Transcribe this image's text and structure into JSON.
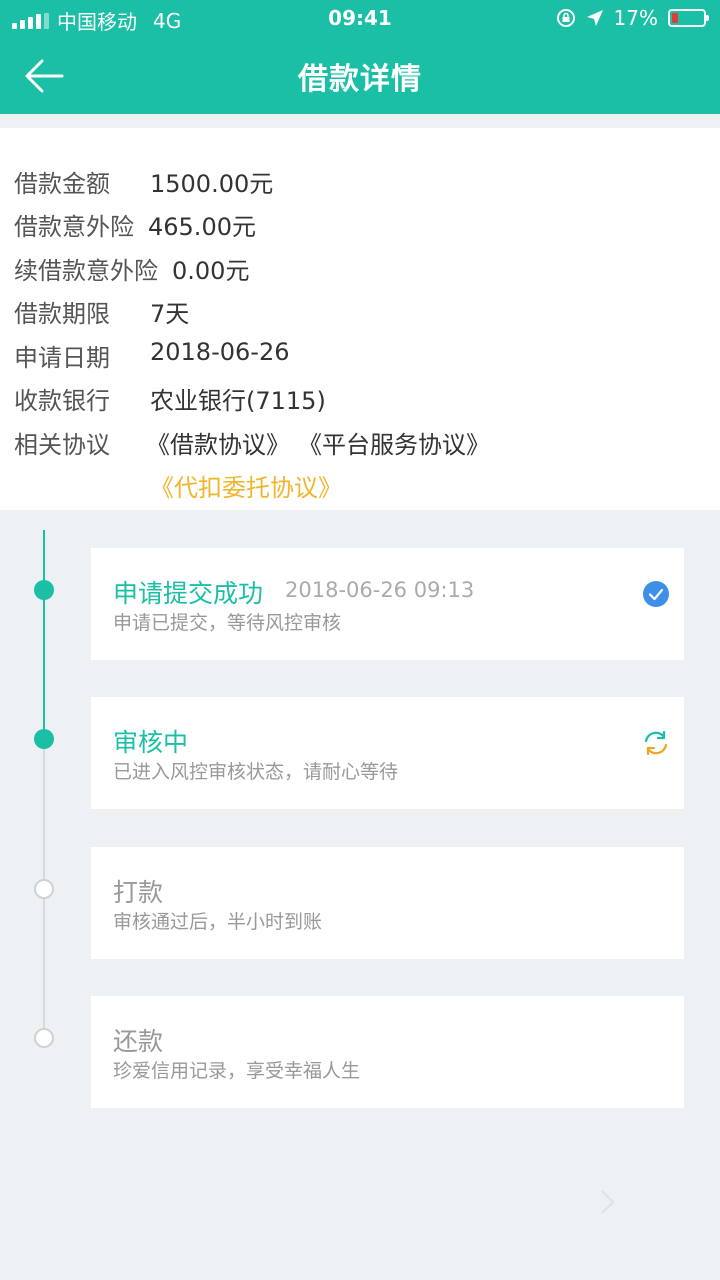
{
  "status_bar": {
    "carrier": "中国移动",
    "network": "4G",
    "time": "09:41",
    "battery": "17%"
  },
  "nav": {
    "title": "借款详情",
    "back_icon": "arrow-left-icon"
  },
  "details": {
    "amount_label": "借款金额",
    "amount_value": "1500.00元",
    "insurance_label": "借款意外险",
    "insurance_value": "465.00元",
    "renew_insurance_label": "续借款意外险",
    "renew_insurance_value": "0.00元",
    "term_label": "借款期限",
    "term_value": "7天",
    "apply_date_label": "申请日期",
    "apply_date_value": "2018-06-26",
    "bank_label": "收款银行",
    "bank_value": "农业银行(7115)",
    "agreements_label": "相关协议",
    "agreement_1": "《借款协议》",
    "agreement_2": "《平台服务协议》",
    "agreement_3": "《代扣委托协议》"
  },
  "timeline": {
    "step1_title": "申请提交成功",
    "step1_time": "2018-06-26 09:13",
    "step1_desc": "申请已提交，等待风控审核",
    "step2_title": "审核中",
    "step2_desc": "已进入风控审核状态，请耐心等待",
    "step3_title": "打款",
    "step3_desc": "审核通过后，半小时到账",
    "step4_title": "还款",
    "step4_desc": "珍爱信用记录，享受幸福人生"
  },
  "colors": {
    "primary": "#1bbfa5",
    "link": "#f0b52a",
    "check": "#3d8fe8",
    "refresh_a": "#1bbfa5",
    "refresh_b": "#f0a520",
    "battery_low": "#e23b3b"
  }
}
